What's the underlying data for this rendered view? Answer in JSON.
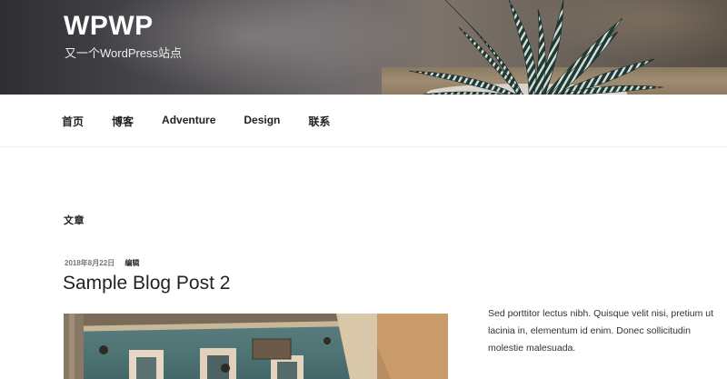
{
  "site": {
    "title": "WPWP",
    "description": "又一个WordPress站点"
  },
  "nav": {
    "items": [
      {
        "label": "首页"
      },
      {
        "label": "博客"
      },
      {
        "label": "Adventure"
      },
      {
        "label": "Design"
      },
      {
        "label": "联系"
      }
    ]
  },
  "main": {
    "heading": "文章",
    "post": {
      "date": "2018年8月22日",
      "edit_label": "编辑",
      "title": "Sample Blog Post 2",
      "excerpt": "Sed porttitor lectus nibh. Quisque velit nisi, pretium ut lacinia in, elementum id enim. Donec sollicitudin molestie malesuada."
    }
  },
  "colors": {
    "text": "#222222",
    "meta": "#767676",
    "nav_border": "#eeeeee",
    "background": "#ffffff"
  }
}
